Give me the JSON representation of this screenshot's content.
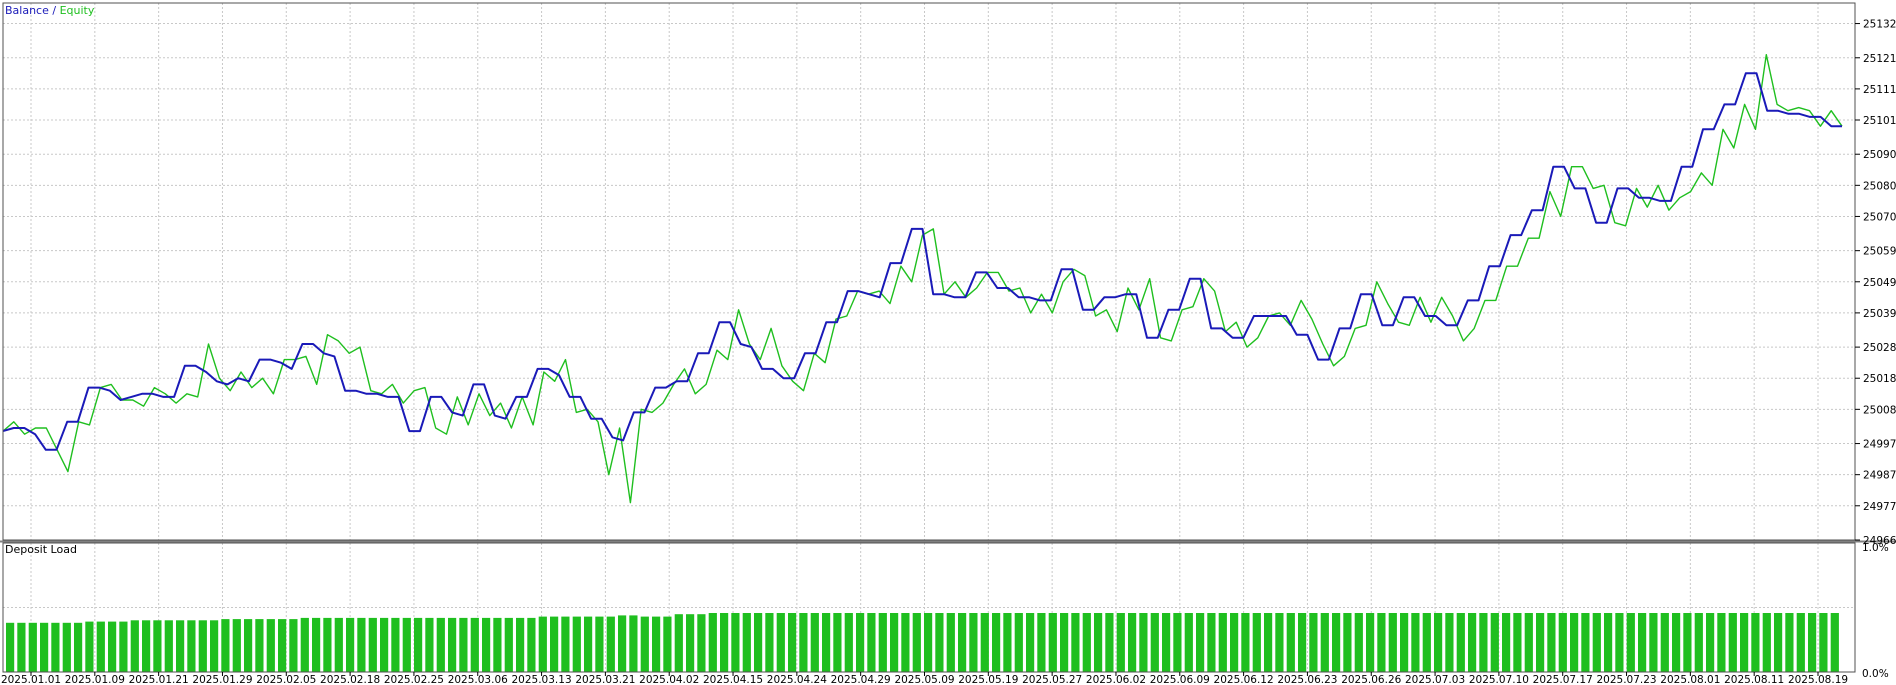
{
  "colors": {
    "balance": "#1a1ab8",
    "equity": "#1fbf1f",
    "grid": "#c8c8c8",
    "bars": "#1fbf1f",
    "frame": "#505050"
  },
  "legend": {
    "balance_label": "Balance",
    "separator": " / ",
    "equity_label": "Equity"
  },
  "lower_panel": {
    "title": "Deposit Load",
    "ymax_label": "1.0%",
    "ymin_label": "0.0%"
  },
  "chart_data": [
    {
      "type": "line",
      "series": [
        {
          "name": "Balance",
          "values": [
            25001,
            25002,
            25002,
            25000,
            24995,
            24995,
            25004,
            25004,
            25015,
            25015,
            25014,
            25011,
            25012,
            25013,
            25013,
            25012,
            25012,
            25022,
            25022,
            25020,
            25017,
            25016,
            25018,
            25017,
            25024,
            25024,
            25023,
            25021,
            25029,
            25029,
            25026,
            25025,
            25014,
            25014,
            25013,
            25013,
            25012,
            25012,
            25001,
            25001,
            25012,
            25012,
            25007,
            25006,
            25016,
            25016,
            25006,
            25005,
            25012,
            25012,
            25021,
            25021,
            25019,
            25012,
            25012,
            25005,
            25005,
            24999,
            24998,
            25007,
            25007,
            25015,
            25015,
            25017,
            25017,
            25026,
            25026,
            25036,
            25036,
            25029,
            25028,
            25021,
            25021,
            25018,
            25018,
            25026,
            25026,
            25036,
            25036,
            25046,
            25046,
            25045,
            25044,
            25055,
            25055,
            25066,
            25066,
            25045,
            25045,
            25044,
            25044,
            25052,
            25052,
            25047,
            25047,
            25044,
            25044,
            25043,
            25043,
            25053,
            25053,
            25040,
            25040,
            25044,
            25044,
            25045,
            25045,
            25031,
            25031,
            25040,
            25040,
            25050,
            25050,
            25034,
            25034,
            25031,
            25031,
            25038,
            25038,
            25038,
            25038,
            25032,
            25032,
            25024,
            25024,
            25034,
            25034,
            25045,
            25045,
            25035,
            25035,
            25044,
            25044,
            25038,
            25038,
            25035,
            25035,
            25043,
            25043,
            25054,
            25054,
            25064,
            25064,
            25072,
            25072,
            25086,
            25086,
            25079,
            25079,
            25068,
            25068,
            25079,
            25079,
            25076,
            25076,
            25075,
            25075,
            25086,
            25086,
            25098,
            25098,
            25106,
            25106,
            25116,
            25116,
            25104,
            25104,
            25103,
            25103,
            25102,
            25102,
            25099,
            25099
          ]
        },
        {
          "name": "Equity",
          "values": [
            25001,
            25004,
            25000,
            25002,
            25002,
            24995,
            24988,
            25004,
            25003,
            25015,
            25016,
            25011,
            25011,
            25009,
            25015,
            25013,
            25010,
            25013,
            25012,
            25029,
            25018,
            25014,
            25020,
            25015,
            25018,
            25013,
            25024,
            25024,
            25025,
            25016,
            25032,
            25030,
            25026,
            25028,
            25014,
            25013,
            25016,
            25010,
            25014,
            25015,
            25002,
            25000,
            25012,
            25003,
            25013,
            25006,
            25010,
            25002,
            25012,
            25003,
            25020,
            25017,
            25024,
            25007,
            25008,
            25004,
            24987,
            25002,
            24978,
            25008,
            25007,
            25010,
            25016,
            25021,
            25013,
            25016,
            25027,
            25024,
            25040,
            25029,
            25024,
            25034,
            25022,
            25017,
            25014,
            25026,
            25023,
            25037,
            25038,
            25046,
            25045,
            25046,
            25042,
            25054,
            25049,
            25064,
            25066,
            25045,
            25049,
            25044,
            25047,
            25052,
            25052,
            25046,
            25047,
            25039,
            25045,
            25039,
            25049,
            25053,
            25051,
            25038,
            25040,
            25033,
            25047,
            25040,
            25050,
            25031,
            25030,
            25040,
            25041,
            25050,
            25046,
            25033,
            25036,
            25028,
            25031,
            25038,
            25039,
            25035,
            25043,
            25037,
            25029,
            25022,
            25025,
            25034,
            25035,
            25049,
            25042,
            25036,
            25035,
            25044,
            25036,
            25044,
            25038,
            25030,
            25034,
            25043,
            25043,
            25054,
            25054,
            25063,
            25063,
            25078,
            25070,
            25086,
            25086,
            25079,
            25080,
            25068,
            25067,
            25079,
            25073,
            25080,
            25072,
            25076,
            25078,
            25084,
            25080,
            25098,
            25092,
            25106,
            25098,
            25122,
            25106,
            25104,
            25105,
            25104,
            25099,
            25104,
            25099
          ]
        }
      ],
      "ylim": [
        24966,
        25137
      ],
      "yticks": [
        "25132",
        "25121",
        "25111",
        "25101",
        "25090",
        "25080",
        "25070",
        "25059",
        "25049",
        "25039",
        "25028",
        "25018",
        "25008",
        "24997",
        "24987",
        "24977",
        "24966"
      ],
      "grid": true,
      "legend_position": "top-left"
    },
    {
      "type": "bar",
      "title": "Deposit Load",
      "ylim": [
        0,
        1.0
      ],
      "values": [
        0.4,
        0.4,
        0.4,
        0.4,
        0.4,
        0.4,
        0.4,
        0.41,
        0.41,
        0.41,
        0.41,
        0.42,
        0.42,
        0.42,
        0.42,
        0.42,
        0.42,
        0.42,
        0.42,
        0.43,
        0.43,
        0.43,
        0.43,
        0.43,
        0.43,
        0.43,
        0.44,
        0.44,
        0.44,
        0.44,
        0.44,
        0.44,
        0.44,
        0.44,
        0.44,
        0.44,
        0.44,
        0.44,
        0.44,
        0.44,
        0.44,
        0.44,
        0.44,
        0.44,
        0.44,
        0.44,
        0.44,
        0.45,
        0.45,
        0.45,
        0.45,
        0.45,
        0.45,
        0.45,
        0.46,
        0.46,
        0.45,
        0.45,
        0.45,
        0.47,
        0.47,
        0.47,
        0.48,
        0.48,
        0.48,
        0.48,
        0.48,
        0.48,
        0.48,
        0.48,
        0.48,
        0.48,
        0.48,
        0.48,
        0.48,
        0.48,
        0.48,
        0.48,
        0.48,
        0.48,
        0.48,
        0.48,
        0.48,
        0.48,
        0.48,
        0.48,
        0.48,
        0.48,
        0.48,
        0.48,
        0.48,
        0.48,
        0.48,
        0.48,
        0.48,
        0.48,
        0.48,
        0.48,
        0.48,
        0.48,
        0.48,
        0.48,
        0.48,
        0.48,
        0.48,
        0.48,
        0.48,
        0.48,
        0.48,
        0.48,
        0.48,
        0.48,
        0.48,
        0.48,
        0.48,
        0.48,
        0.48,
        0.48,
        0.48,
        0.48,
        0.48,
        0.48,
        0.48,
        0.48,
        0.48,
        0.48,
        0.48,
        0.48,
        0.48,
        0.48,
        0.48,
        0.48,
        0.48,
        0.48,
        0.48,
        0.48,
        0.48,
        0.48,
        0.48,
        0.48,
        0.48,
        0.48,
        0.48,
        0.48,
        0.48,
        0.48,
        0.48,
        0.48,
        0.48,
        0.48,
        0.48,
        0.48,
        0.48,
        0.48,
        0.48,
        0.48,
        0.48,
        0.48,
        0.48,
        0.48,
        0.48,
        0.48
      ]
    }
  ],
  "x_axis": {
    "tick_labels": [
      "2025.01.01",
      "2025.01.09",
      "2025.01.21",
      "2025.01.29",
      "2025.02.05",
      "2025.02.18",
      "2025.02.25",
      "2025.03.06",
      "2025.03.13",
      "2025.03.21",
      "2025.04.02",
      "2025.04.15",
      "2025.04.24",
      "2025.04.29",
      "2025.05.09",
      "2025.05.19",
      "2025.05.27",
      "2025.06.02",
      "2025.06.09",
      "2025.06.12",
      "2025.06.23",
      "2025.06.26",
      "2025.07.03",
      "2025.07.10",
      "2025.07.17",
      "2025.07.23",
      "2025.08.01",
      "2025.08.11",
      "2025.08.19"
    ]
  }
}
